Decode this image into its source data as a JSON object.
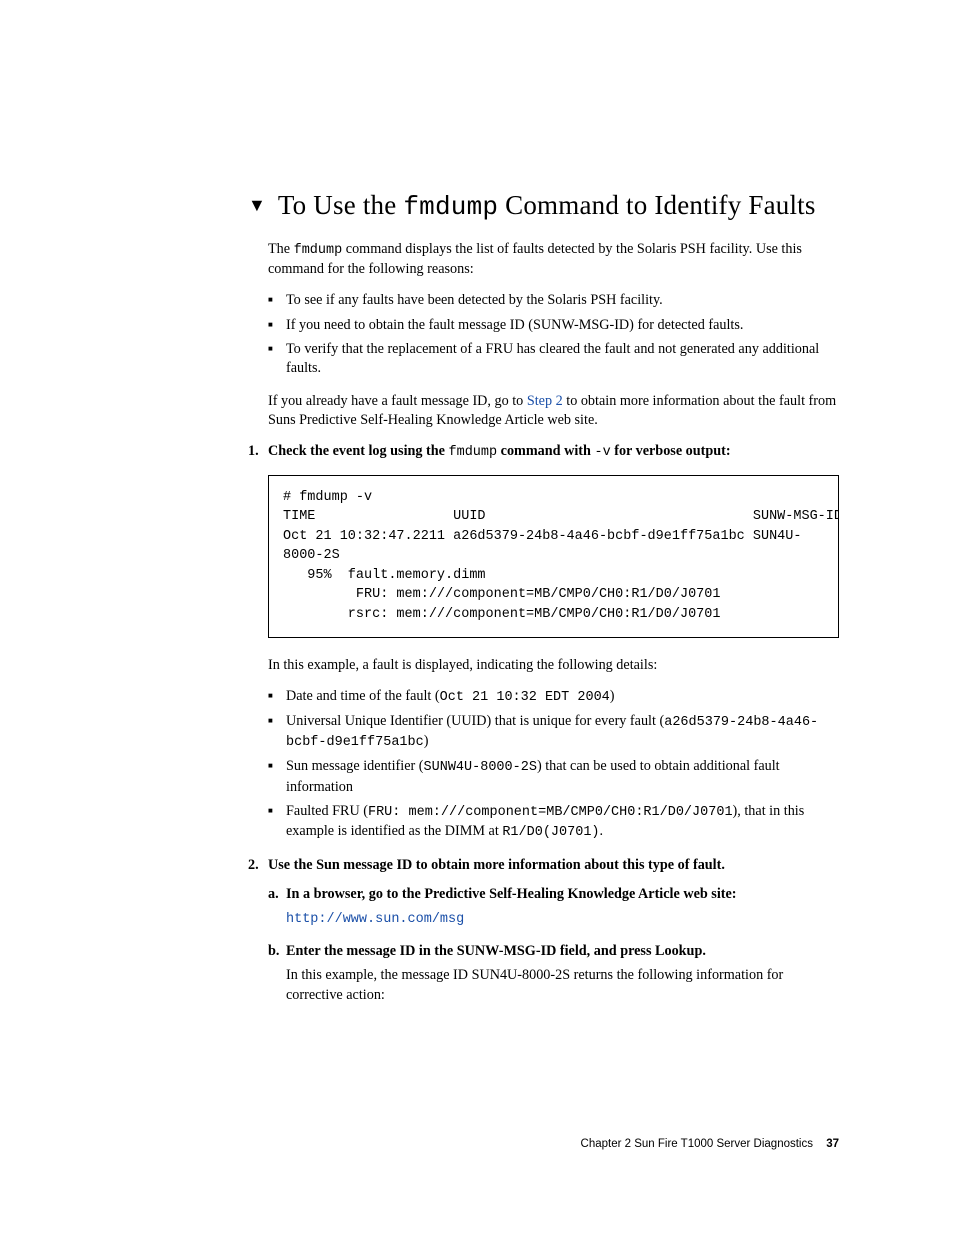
{
  "heading": {
    "pre": "To Use the ",
    "cmd": "fmdump",
    "post": " Command to Identify Faults"
  },
  "intro": {
    "line1_a": "The ",
    "line1_cmd": "fmdump",
    "line1_b": " command displays the list of faults detected by the Solaris PSH facility. Use this command for the following reasons:"
  },
  "reasons": [
    "To see if any faults have been detected by the Solaris PSH facility.",
    "If you need to obtain the fault message ID (SUNW-MSG-ID) for detected faults.",
    "To verify that the replacement of a FRU has cleared the fault and not generated any additional faults."
  ],
  "already": {
    "a": "If you already have a fault message ID, go to ",
    "link": "Step 2",
    "b": " to obtain more information about the fault from Suns Predictive Self-Healing Knowledge Article web site."
  },
  "step1": {
    "title_a": "Check the event log using the ",
    "title_cmd": "fmdump",
    "title_b": " command with ",
    "title_flag": "-v",
    "title_c": " for verbose output:"
  },
  "code": "# fmdump -v\nTIME                 UUID                                 SUNW-MSG-ID\nOct 21 10:32:47.2211 a26d5379-24b8-4a46-bcbf-d9e1ff75a1bc SUN4U-\n8000-2S\n   95%  fault.memory.dimm\n         FRU: mem:///component=MB/CMP0/CH0:R1/D0/J0701\n        rsrc: mem:///component=MB/CMP0/CH0:R1/D0/J0701",
  "after_code": "In this example, a fault is displayed, indicating the following details:",
  "details": {
    "d1_a": "Date and time of the fault (",
    "d1_mono": "Oct 21 10:32 EDT 2004",
    "d1_b": ")",
    "d2_a": "Universal Unique Identifier (UUID) that is unique for every fault (",
    "d2_mono": "a26d5379-24b8-4a46-bcbf-d9e1ff75a1bc",
    "d2_b": ")",
    "d3_a": "Sun message identifier (",
    "d3_mono": "SUNW4U-8000-2S",
    "d3_b": ") that can be used to obtain additional fault information",
    "d4_a": "Faulted FRU (",
    "d4_mono1": "FRU: mem:///component=MB/CMP0/CH0:R1/D0/J0701",
    "d4_b": "), that in this example is identified as the DIMM at ",
    "d4_mono2": "R1/D0(J0701)",
    "d4_c": "."
  },
  "step2": {
    "title": "Use the Sun message ID to obtain more information about this type of fault.",
    "a_title": "In a browser, go to the Predictive Self-Healing Knowledge Article web site:",
    "a_url": "http://www.sun.com/msg",
    "b_title": "Enter the message ID in the SUNW-MSG-ID field, and press Lookup.",
    "b_body": "In this example, the message ID SUN4U-8000-2S returns the following information for corrective action:"
  },
  "footer": {
    "chapter": "Chapter 2    Sun Fire T1000 Server Diagnostics",
    "page": "37"
  }
}
